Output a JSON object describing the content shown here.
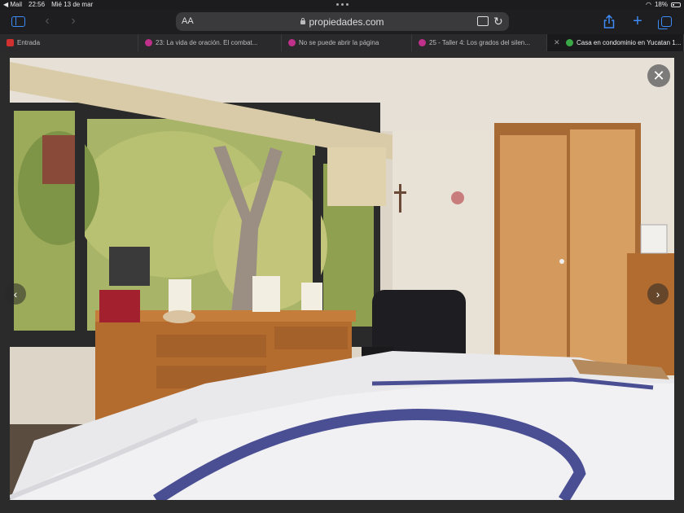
{
  "status": {
    "carrier": "◀ Mail",
    "time": "22:56",
    "date": "Mié 13 de mar",
    "battery": "18%"
  },
  "toolbar": {
    "reader_label": "AA",
    "url": "propiedades.com"
  },
  "tabs": [
    {
      "label": "Entrada",
      "color": "#d03030"
    },
    {
      "label": "23: La vida de oración. El combat...",
      "color": "#c0308a"
    },
    {
      "label": "No se puede abrir la página",
      "color": "#c0308a"
    },
    {
      "label": "25 - Taller 4: Los grados del silen...",
      "color": "#c0308a"
    },
    {
      "label": "Casa en condominio en Yucatan 1...",
      "color": "#3aa845"
    }
  ],
  "gallery": {
    "close_label": "✕",
    "prev_label": "‹",
    "next_label": "›"
  }
}
